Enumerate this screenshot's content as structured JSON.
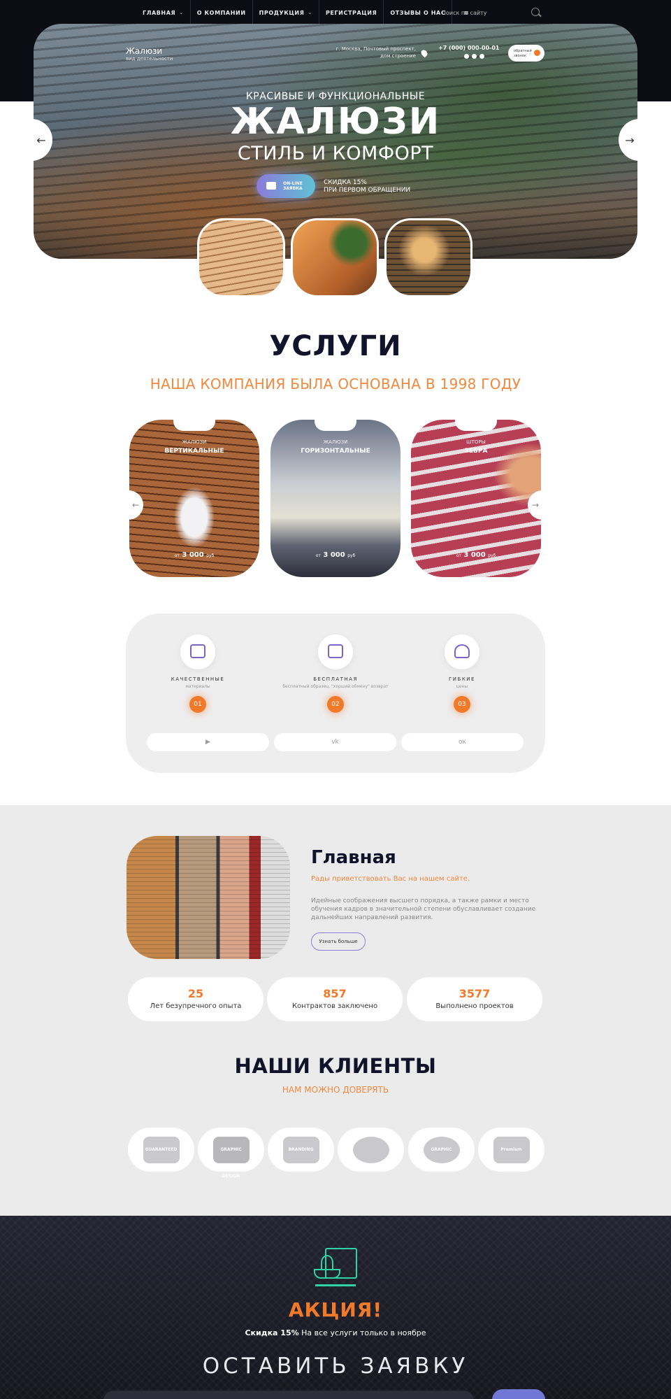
{
  "nav": {
    "items": [
      {
        "label": "ГЛАВНАЯ",
        "dropdown": true
      },
      {
        "label": "О КОМПАНИИ",
        "dropdown": false
      },
      {
        "label": "ПРОДУКЦИЯ",
        "dropdown": true
      },
      {
        "label": "РЕГИСТРАЦИЯ",
        "dropdown": false
      },
      {
        "label": "ОТЗЫВЫ О НАС",
        "dropdown": false
      }
    ],
    "search_placeholder": "Поиск по сайту"
  },
  "hero": {
    "logo": "Жалюзи",
    "logo_sub": "вид деятельности",
    "address": "г. Москва, Почтовый проспект, дом строение",
    "phone": "+7 (000) 000-00-01",
    "callback_label": "обратный звонок",
    "subtitle": "КРАСИВЫЕ И ФУНКЦИОНАЛЬНЫЕ",
    "title": "ЖАЛЮЗИ",
    "title2": "СТИЛЬ И КОМФОРТ",
    "online_button": "ON-LINE ЗАЯВКА",
    "discount_line1": "СКИДКА 15%",
    "discount_line2": "ПРИ ПЕРВОМ ОБРАЩЕНИИ",
    "arrow_prev": "←",
    "arrow_next": "→"
  },
  "services": {
    "title": "УСЛУГИ",
    "subtitle": "НАША КОМПАНИЯ БЫЛА ОСНОВАНА В 1998 ГОДУ",
    "cards": [
      {
        "label1": "ЖАЛЮЗИ",
        "label2": "ВЕРТИКАЛЬНЫЕ",
        "price_prefix": "от",
        "price": "3 000",
        "currency": "руб"
      },
      {
        "label1": "ЖАЛЮЗИ",
        "label2": "ГОРИЗОНТАЛЬНЫЕ",
        "price_prefix": "от",
        "price": "3 000",
        "currency": "руб"
      },
      {
        "label1": "ШТОРЫ",
        "label2": "ЗЕБРА",
        "price_prefix": "от",
        "price": "3 000",
        "currency": "руб"
      }
    ]
  },
  "features": {
    "items": [
      {
        "title": "КАЧЕСТВЕННЫЕ",
        "sub": "материалы",
        "num": "01"
      },
      {
        "title": "БЕСПЛАТНАЯ",
        "sub": "бесплатный образец, \"хорший обмену\" возврат",
        "num": "02"
      },
      {
        "title": "ГИБКИЕ",
        "sub": "цены",
        "num": "03"
      }
    ],
    "socials": [
      "youtube-icon",
      "vk-icon",
      "odnoklassniki-icon"
    ],
    "social_glyphs": [
      "▶",
      "vk",
      "ок"
    ]
  },
  "about": {
    "title": "Главная",
    "subtitle": "Рады приветствовать Вас на нашем сайте.",
    "text": "Идейные соображения высшего порядка, а также рамки и место обучения кадров в значительной степени обуславливает создание дальнейших направлений развития.",
    "button": "Узнать больше"
  },
  "stats": [
    {
      "value": "25",
      "label": "Лет безупречного опыта"
    },
    {
      "value": "857",
      "label": "Контрактов заключено"
    },
    {
      "value": "3577",
      "label": "Выполнено проектов"
    }
  ],
  "clients": {
    "title": "НАШИ КЛИЕНТЫ",
    "subtitle": "НАМ МОЖНО ДОВЕРЯТЬ",
    "logos": [
      "GUARANTEED",
      "GRAPHIC DESIGN",
      "BRANDING",
      "",
      "GRAPHIC",
      "Premium"
    ]
  },
  "promo": {
    "title": "АКЦИЯ!",
    "sub_bold": "Скидка 15%",
    "sub_rest": " На все услуги только в ноябре",
    "request_title": "ОСТАВИТЬ ЗАЯВКУ"
  },
  "colors": {
    "accent": "#f07a2a",
    "dark": "#0c0d14",
    "purple": "#7a64c5",
    "teal": "#2dd4a5"
  }
}
